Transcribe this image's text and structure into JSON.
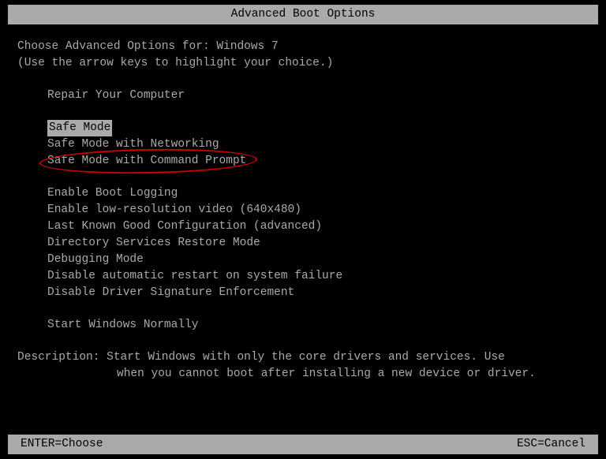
{
  "title": "Advanced Boot Options",
  "header1": "Choose Advanced Options for: Windows 7",
  "header2": "(Use the arrow keys to highlight your choice.)",
  "repair": "Repair Your Computer",
  "options": {
    "safe_mode": "Safe Mode",
    "safe_mode_net": "Safe Mode with Networking",
    "safe_mode_cmd": "Safe Mode with Command Prompt",
    "boot_logging": "Enable Boot Logging",
    "low_res": "Enable low-resolution video (640x480)",
    "lkgc": "Last Known Good Configuration (advanced)",
    "dsrm": "Directory Services Restore Mode",
    "debug": "Debugging Mode",
    "no_auto_restart": "Disable automatic restart on system failure",
    "no_driver_sig": "Disable Driver Signature Enforcement",
    "start_normal": "Start Windows Normally"
  },
  "description_label": "Description: ",
  "description_line1": "Start Windows with only the core drivers and services. Use",
  "description_line2": "when you cannot boot after installing a new device or driver.",
  "footer_left": "ENTER=Choose",
  "footer_right": "ESC=Cancel"
}
